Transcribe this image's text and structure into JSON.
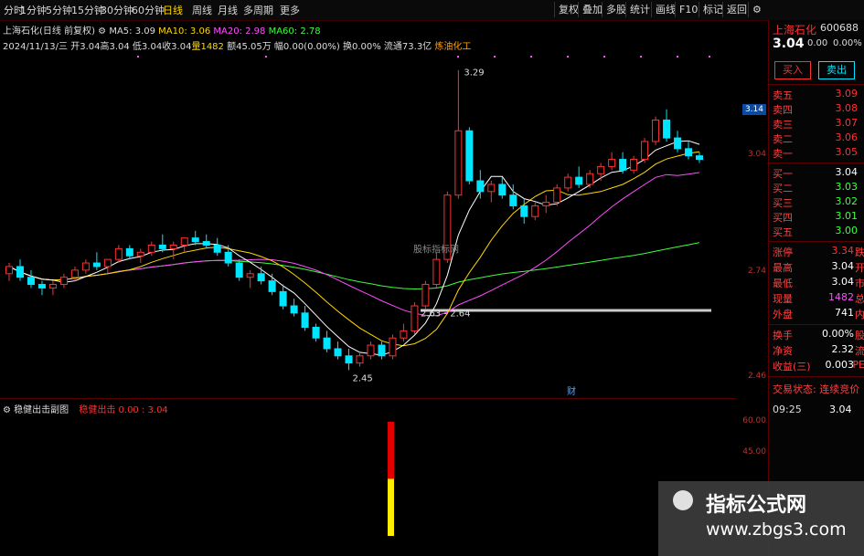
{
  "toolbar": {
    "periods": [
      "分时",
      "1分钟",
      "5分钟",
      "15分钟",
      "30分钟",
      "60分钟",
      "日线",
      "周线",
      "月线",
      "多周期",
      "更多"
    ],
    "active_period": "日线",
    "buttons": [
      "复权",
      "叠加",
      "多股",
      "统计",
      "画线",
      "F10",
      "标记",
      "返回"
    ]
  },
  "info_line1": {
    "title": "上海石化(日线 前复权)",
    "ma5": "MA5: 3.09",
    "ma10": "MA10: 3.06",
    "ma20": "MA20: 2.98",
    "ma60": "MA60: 2.78"
  },
  "info_line2": {
    "date": "2024/11/13/三",
    "open": "开3.04",
    "high": "高3.04",
    "low": "低3.04",
    "close": "收3.04",
    "volume": "量1482",
    "amount": "额45.05万",
    "change": "幅0.00(0.00%)",
    "turnover": "换0.00%",
    "float": "流通73.3亿",
    "sector": "炼油化工"
  },
  "chart_labels": {
    "peak": "3.29",
    "trough": "2.45",
    "range": "2.63 - 2.64",
    "watermark_mid": "股标指标网",
    "cai": "财"
  },
  "price_axis": {
    "ticks": [
      "3.14",
      "3.04",
      "2.74",
      "2.46"
    ],
    "highlight": "3.14"
  },
  "sub_panel": {
    "title": "稳健出击副图",
    "indicator": "稳健出击",
    "values": "0.00 : 3.04",
    "axis_ticks": [
      "60.00",
      "45.00"
    ],
    "bar_value_red": 60,
    "bar_value_yellow": 30
  },
  "right_panel": {
    "stock_name": "上海石化",
    "stock_code": "600688",
    "price": "3.04",
    "change": "0.00",
    "change_pct": "0.00%",
    "buy_label": "买入",
    "sell_label": "卖出",
    "asks": [
      {
        "label": "卖五",
        "price": "3.09"
      },
      {
        "label": "卖四",
        "price": "3.08"
      },
      {
        "label": "卖三",
        "price": "3.07"
      },
      {
        "label": "卖二",
        "price": "3.06"
      },
      {
        "label": "卖一",
        "price": "3.05"
      }
    ],
    "bids": [
      {
        "label": "买一",
        "price": "3.04"
      },
      {
        "label": "买二",
        "price": "3.03"
      },
      {
        "label": "买三",
        "price": "3.02"
      },
      {
        "label": "买四",
        "price": "3.01"
      },
      {
        "label": "买五",
        "price": "3.00"
      }
    ],
    "stats": [
      {
        "label": "涨停",
        "value": "3.34",
        "suffix": "跌"
      },
      {
        "label": "最高",
        "value": "3.04",
        "suffix": "开"
      },
      {
        "label": "最低",
        "value": "3.04",
        "suffix": "市"
      },
      {
        "label": "现量",
        "value": "1482",
        "suffix": "总"
      },
      {
        "label": "外盘",
        "value": "741",
        "suffix": "内"
      }
    ],
    "stats2": [
      {
        "label": "换手",
        "value": "0.00%",
        "suffix": "股"
      },
      {
        "label": "净资",
        "value": "2.32",
        "suffix": "流"
      },
      {
        "label": "收益(三)",
        "value": "0.003",
        "suffix": "PE"
      }
    ],
    "trade_status": "交易状态: 连续竞价",
    "tick_time": "09:25",
    "tick_price": "3.04"
  },
  "watermark": {
    "line1": "指标公式网",
    "line2": "www.zbgs3.com"
  },
  "colors": {
    "up": "#ff3030",
    "down": "#00e5ff",
    "ma5": "#ffffff",
    "ma10": "#ffd800",
    "ma20": "#ff4dff",
    "ma60": "#3dff3d"
  },
  "chart_data": {
    "type": "candlestick",
    "ylim": [
      2.4,
      3.32
    ],
    "candles": [
      [
        2.72,
        2.75,
        2.7,
        2.74
      ],
      [
        2.74,
        2.76,
        2.7,
        2.71
      ],
      [
        2.71,
        2.73,
        2.68,
        2.69
      ],
      [
        2.69,
        2.7,
        2.66,
        2.68
      ],
      [
        2.68,
        2.7,
        2.66,
        2.69
      ],
      [
        2.69,
        2.72,
        2.68,
        2.71
      ],
      [
        2.71,
        2.74,
        2.7,
        2.73
      ],
      [
        2.73,
        2.76,
        2.72,
        2.75
      ],
      [
        2.75,
        2.78,
        2.73,
        2.74
      ],
      [
        2.74,
        2.76,
        2.72,
        2.76
      ],
      [
        2.76,
        2.8,
        2.75,
        2.79
      ],
      [
        2.79,
        2.8,
        2.76,
        2.77
      ],
      [
        2.77,
        2.79,
        2.75,
        2.78
      ],
      [
        2.78,
        2.81,
        2.77,
        2.8
      ],
      [
        2.8,
        2.83,
        2.78,
        2.79
      ],
      [
        2.79,
        2.81,
        2.76,
        2.8
      ],
      [
        2.8,
        2.82,
        2.78,
        2.82
      ],
      [
        2.82,
        2.84,
        2.8,
        2.81
      ],
      [
        2.81,
        2.83,
        2.79,
        2.8
      ],
      [
        2.8,
        2.82,
        2.77,
        2.78
      ],
      [
        2.78,
        2.8,
        2.74,
        2.75
      ],
      [
        2.75,
        2.76,
        2.7,
        2.71
      ],
      [
        2.71,
        2.73,
        2.68,
        2.72
      ],
      [
        2.72,
        2.74,
        2.69,
        2.7
      ],
      [
        2.7,
        2.72,
        2.66,
        2.67
      ],
      [
        2.67,
        2.69,
        2.62,
        2.63
      ],
      [
        2.63,
        2.65,
        2.6,
        2.61
      ],
      [
        2.61,
        2.63,
        2.56,
        2.57
      ],
      [
        2.57,
        2.58,
        2.53,
        2.54
      ],
      [
        2.54,
        2.56,
        2.5,
        2.51
      ],
      [
        2.51,
        2.53,
        2.48,
        2.49
      ],
      [
        2.49,
        2.51,
        2.45,
        2.47
      ],
      [
        2.47,
        2.5,
        2.46,
        2.49
      ],
      [
        2.49,
        2.53,
        2.48,
        2.52
      ],
      [
        2.52,
        2.53,
        2.48,
        2.49
      ],
      [
        2.49,
        2.55,
        2.48,
        2.54
      ],
      [
        2.54,
        2.58,
        2.53,
        2.56
      ],
      [
        2.56,
        2.64,
        2.55,
        2.63
      ],
      [
        2.63,
        2.7,
        2.62,
        2.69
      ],
      [
        2.69,
        2.78,
        2.68,
        2.76
      ],
      [
        2.76,
        2.95,
        2.75,
        2.94
      ],
      [
        2.94,
        3.29,
        2.93,
        3.12
      ],
      [
        3.12,
        3.13,
        2.97,
        2.98
      ],
      [
        2.98,
        3.01,
        2.93,
        2.95
      ],
      [
        2.95,
        2.98,
        2.92,
        2.97
      ],
      [
        2.97,
        2.99,
        2.93,
        2.94
      ],
      [
        2.94,
        2.97,
        2.9,
        2.91
      ],
      [
        2.91,
        2.93,
        2.86,
        2.88
      ],
      [
        2.88,
        2.92,
        2.87,
        2.91
      ],
      [
        2.91,
        2.94,
        2.89,
        2.92
      ],
      [
        2.92,
        2.97,
        2.91,
        2.96
      ],
      [
        2.96,
        3.0,
        2.95,
        2.99
      ],
      [
        2.99,
        3.02,
        2.96,
        2.97
      ],
      [
        2.97,
        3.01,
        2.96,
        3.0
      ],
      [
        3.0,
        3.03,
        2.98,
        3.02
      ],
      [
        3.02,
        3.06,
        3.01,
        3.04
      ],
      [
        3.04,
        3.06,
        3.0,
        3.01
      ],
      [
        3.01,
        3.05,
        3.0,
        3.04
      ],
      [
        3.04,
        3.1,
        3.03,
        3.09
      ],
      [
        3.09,
        3.16,
        3.08,
        3.15
      ],
      [
        3.15,
        3.18,
        3.09,
        3.1
      ],
      [
        3.1,
        3.12,
        3.06,
        3.07
      ],
      [
        3.07,
        3.09,
        3.04,
        3.05
      ],
      [
        3.05,
        3.06,
        3.03,
        3.04
      ]
    ]
  }
}
